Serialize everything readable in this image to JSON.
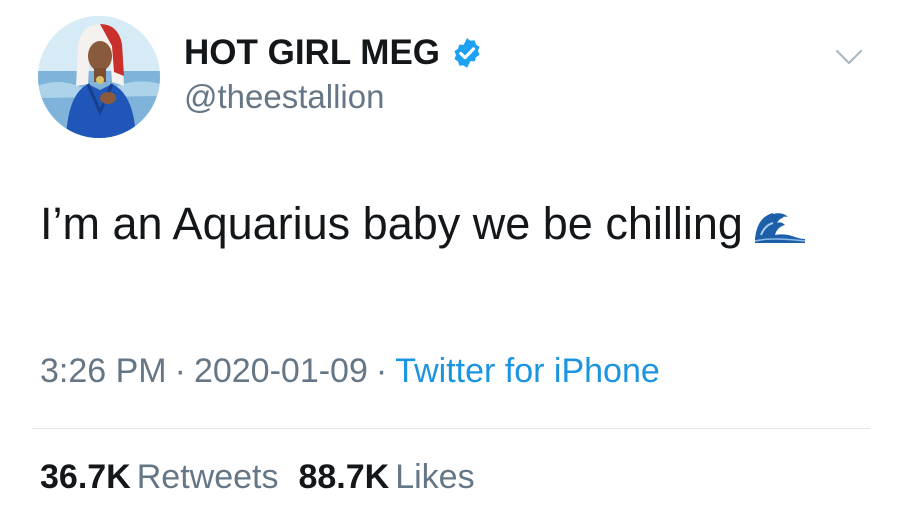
{
  "user": {
    "display_name": "HOT GIRL MEG",
    "handle": "@theestallion",
    "verified": true
  },
  "tweet": {
    "text": "I’m an Aquarius baby we be chilling",
    "emoji": "water-wave-emoji",
    "time": "3:26 PM",
    "date": "2020-01-09",
    "separator": "·",
    "source": "Twitter for iPhone"
  },
  "stats": {
    "retweets_count": "36.7K",
    "retweets_label": "Retweets",
    "likes_count": "88.7K",
    "likes_label": "Likes"
  },
  "colors": {
    "text": "#14171a",
    "secondary": "#657786",
    "link": "#1b95e0",
    "verified": "#1da1f2",
    "divider": "#e1e8ed"
  }
}
